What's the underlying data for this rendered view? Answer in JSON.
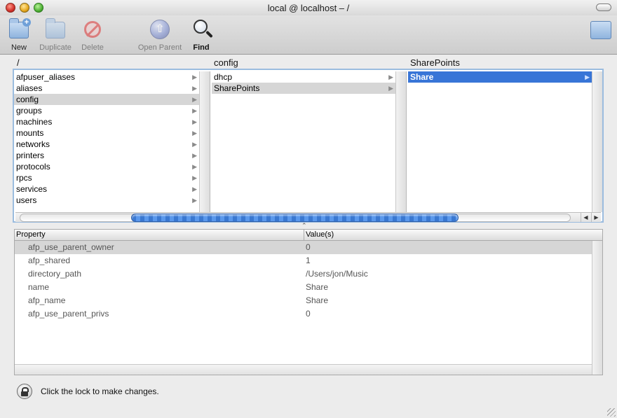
{
  "window": {
    "title": "local @ localhost – /"
  },
  "toolbar": {
    "new_label": "New",
    "duplicate_label": "Duplicate",
    "delete_label": "Delete",
    "open_parent_label": "Open Parent",
    "find_label": "Find"
  },
  "browser": {
    "columns": [
      {
        "header": "/",
        "items": [
          "afpuser_aliases",
          "aliases",
          "config",
          "groups",
          "machines",
          "mounts",
          "networks",
          "printers",
          "protocols",
          "rpcs",
          "services",
          "users"
        ],
        "selected": "config"
      },
      {
        "header": "config",
        "items": [
          "dhcp",
          "SharePoints"
        ],
        "selected": "SharePoints"
      },
      {
        "header": "SharePoints",
        "items": [
          "Share"
        ],
        "selected": "Share"
      }
    ]
  },
  "properties": {
    "col_property": "Property",
    "col_values": "Value(s)",
    "rows": [
      {
        "name": "afp_use_parent_owner",
        "value": "0"
      },
      {
        "name": "afp_shared",
        "value": "1"
      },
      {
        "name": "directory_path",
        "value": "/Users/jon/Music"
      },
      {
        "name": "name",
        "value": "Share"
      },
      {
        "name": "afp_name",
        "value": "Share"
      },
      {
        "name": "afp_use_parent_privs",
        "value": "0"
      }
    ]
  },
  "status": {
    "lock_text": "Click the lock to make changes."
  },
  "colors": {
    "selection_blue": "#3875d7",
    "selection_gray": "#d6d6d6",
    "focus_ring": "#9bbcdf"
  }
}
